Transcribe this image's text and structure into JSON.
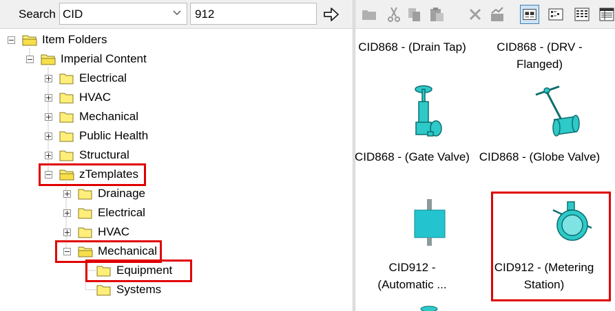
{
  "search": {
    "label": "Search",
    "field": "CID",
    "query": "912"
  },
  "tree": {
    "root": "Item Folders",
    "imperial": "Imperial Content",
    "electrical": "Electrical",
    "hvac": "HVAC",
    "mechanical": "Mechanical",
    "public_health": "Public Health",
    "structural": "Structural",
    "ztemplates": "zTemplates",
    "drainage": "Drainage",
    "z_electrical": "Electrical",
    "z_hvac": "HVAC",
    "z_mechanical": "Mechanical",
    "equipment": "Equipment",
    "systems": "Systems"
  },
  "toolbar": {
    "icons": [
      "folder-icon",
      "cut-icon",
      "copy-icon",
      "paste-icon",
      "delete-icon",
      "chart-icon",
      "large-icons-view",
      "small-icons-view",
      "list-view",
      "details-view"
    ]
  },
  "items": {
    "drain_tap": "CID868 - (Drain Tap)",
    "drv_flanged": "CID868 - (DRV - Flanged)",
    "gate_valve": "CID868 - (Gate Valve)",
    "globe_valve": "CID868 - (Globe Valve)",
    "automatic": "CID912 - (Automatic ...",
    "metering": "CID912 - (Metering Station)"
  },
  "colors": {
    "highlight": "#e00000",
    "item_cyan": "#2ec9c9",
    "folder_yellow": "#ffef7a"
  }
}
